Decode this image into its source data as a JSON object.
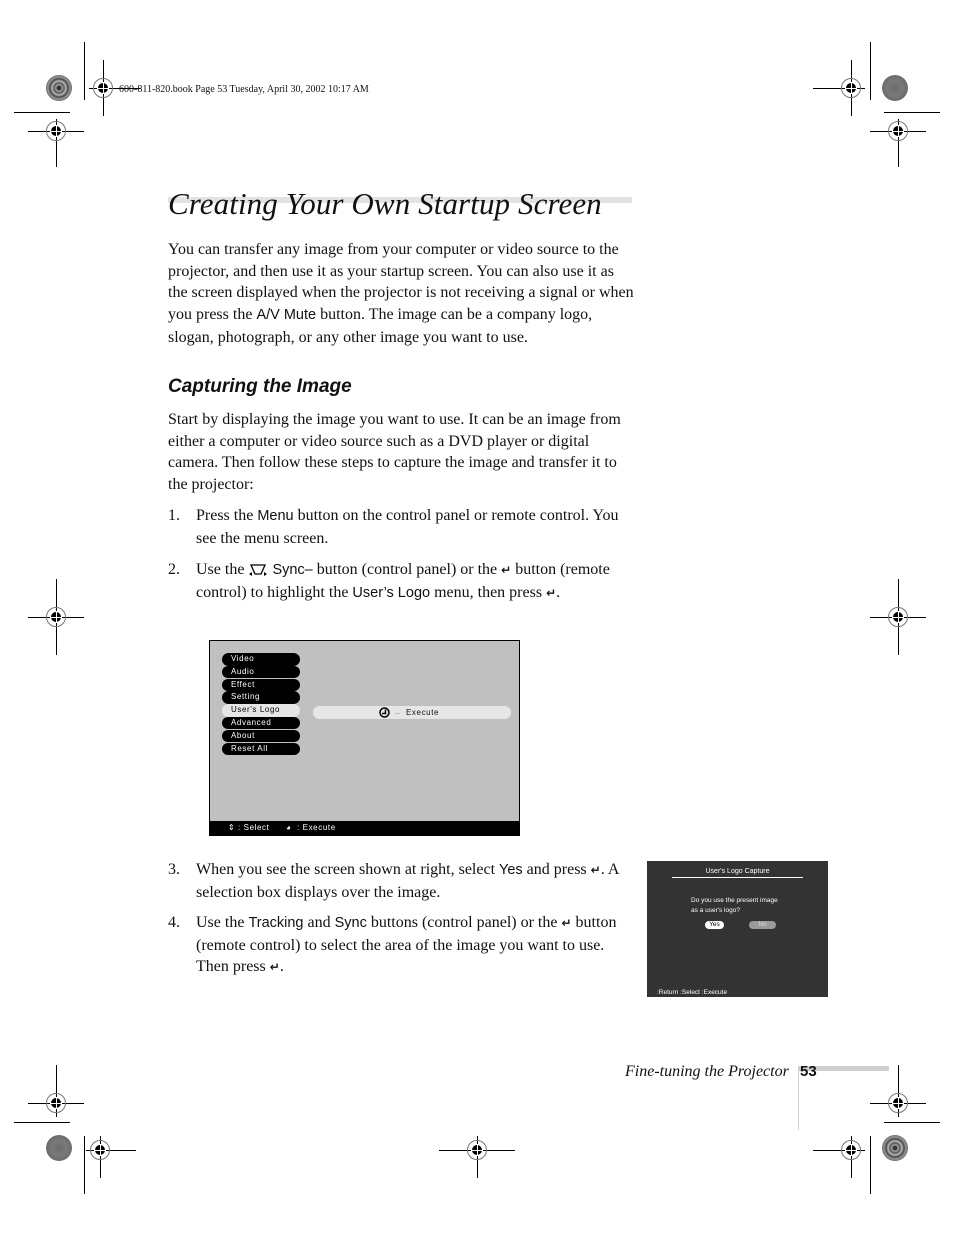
{
  "slug": "600-811-820.book  Page 53  Tuesday, April 30, 2002  10:17 AM",
  "title": "Creating Your Own Startup Screen",
  "intro": {
    "before": "You can transfer any image from your computer or video source to the projector, and then use it as your startup screen. You can also use it as the screen displayed when the projector is not receiving a signal or when you press the ",
    "button": "A/V Mute",
    "after": " button. The image can be a company logo, slogan, photograph, or any other image you want to use."
  },
  "section_heading": "Capturing the Image",
  "section_intro": "Start by displaying the image you want to use. It can be an image from either a computer or video source such as a DVD player or digital camera. Then follow these steps to capture the image and transfer it to the projector:",
  "steps": [
    {
      "num": "1.",
      "a": "Press the ",
      "key": "Menu",
      "b": " button on the control panel or remote control. You see the menu screen."
    },
    {
      "num": "2.",
      "a": "Use the ",
      "key1": "Sync–",
      "b": " button (control panel) or the ",
      "enter1": "↵",
      "c": " button (remote control) to highlight the ",
      "key2": "User’s Logo",
      "d": " menu, then press ",
      "enter2": "↵",
      "e": "."
    },
    {
      "num": "3.",
      "a": "When you see the screen shown at right, select ",
      "key": "Yes",
      "b": " and press ",
      "enter": "↵",
      "c": ". A selection box displays over the image."
    },
    {
      "num": "4.",
      "a": "Use the ",
      "key1": "Tracking",
      "b": " and ",
      "key2": "Sync",
      "c": " buttons (control panel) or the ",
      "enter1": "↵",
      "d": " button (remote control) to select the area of the image you want to use. Then press ",
      "enter2": "↵",
      "e": "."
    }
  ],
  "menu_screen": {
    "items": [
      "Video",
      "Audio",
      "Effect",
      "Setting",
      "User's Logo",
      "Advanced",
      "About",
      "Reset All"
    ],
    "selected_index": 4,
    "execute_label": "Execute",
    "footer_select": ": Select",
    "footer_execute": ": Execute"
  },
  "capture_dialog": {
    "title": "User's Logo Capture",
    "question_line1": "Do you use the present image",
    "question_line2": "as a user's logo?",
    "yes": "Yes",
    "no": "No",
    "footer": ":Return   :Select   :Execute"
  },
  "footer": {
    "section": "Fine-tuning the Projector",
    "page": "53"
  }
}
